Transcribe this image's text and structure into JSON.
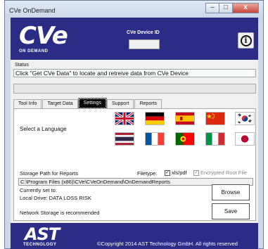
{
  "window": {
    "title": "CVe OnDemand",
    "minimize_glyph": "–",
    "maximize_glyph": "□",
    "close_glyph": "x"
  },
  "header": {
    "logo_text": "CVe",
    "logo_subtext": "ON DEMAND",
    "device_id_label": "CVe Device ID",
    "device_id_value": "",
    "info_glyph": "i"
  },
  "status": {
    "label": "Status",
    "message": "Click \"Get CVe Data\" to locate and retreive data from CVe Device",
    "progress": 0
  },
  "tabs": [
    {
      "label": "Tool Info",
      "active": false
    },
    {
      "label": "Target Data",
      "active": false
    },
    {
      "label": "Settings",
      "active": true
    },
    {
      "label": "Support",
      "active": false
    },
    {
      "label": "Reports",
      "active": false
    }
  ],
  "settings": {
    "language_label": "Select a Language",
    "flags": [
      {
        "name": "uk-flag-icon"
      },
      {
        "name": "germany-flag-icon"
      },
      {
        "name": "spain-flag-icon"
      },
      {
        "name": "china-flag-icon"
      },
      {
        "name": "south-korea-flag-icon"
      },
      {
        "name": "thailand-flag-icon"
      },
      {
        "name": "france-flag-icon"
      },
      {
        "name": "portugal-flag-icon"
      },
      {
        "name": "italy-flag-icon"
      },
      {
        "name": "japan-flag-icon"
      }
    ],
    "storage_label": "Storage Path for Reports",
    "filetype_label": "Filetype:",
    "xls_pdf_label": "xls/pdf",
    "xls_pdf_checked": true,
    "encrypted_label": "Encrypted Root File",
    "encrypted_checked": true,
    "path": "C:\\Program Files (x86)\\CVe\\CVeOnDemand\\OnDemandReports",
    "currently_set_label": "Currently set to:",
    "drive_label": "Local Drive: DATA LOSS RISK",
    "network_label": "Network Storage is recommended",
    "browse_label": "Browse",
    "save_label": "Save",
    "check_glyph": "✓"
  },
  "footer": {
    "logo_text": "AST",
    "logo_subtext": "TECHNOLOGY",
    "copyright": "©Copyright 2014 AST Technology GmbH. All rights reserved"
  },
  "colors": {
    "brand_blue": "#2b2c85",
    "progress_green": "#06b025"
  }
}
